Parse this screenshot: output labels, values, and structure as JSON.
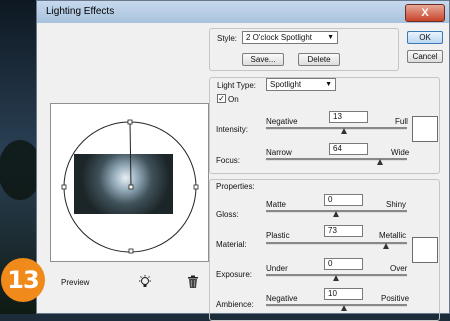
{
  "dialog": {
    "title": "Lighting Effects",
    "close_label": "X"
  },
  "style_group": {
    "style_label": "Style:",
    "style_value": "2 O'clock Spotlight",
    "save_label": "Save...",
    "delete_label": "Delete"
  },
  "buttons": {
    "ok": "OK",
    "cancel": "Cancel"
  },
  "light_type": {
    "label": "Light Type:",
    "value": "Spotlight",
    "on_label": "On",
    "on_checked": "✓"
  },
  "intensity": {
    "label": "Intensity:",
    "left": "Negative",
    "right": "Full",
    "value": "13"
  },
  "focus": {
    "label": "Focus:",
    "left": "Narrow",
    "right": "Wide",
    "value": "64"
  },
  "properties": {
    "label": "Properties:"
  },
  "gloss": {
    "label": "Gloss:",
    "left": "Matte",
    "right": "Shiny",
    "value": "0"
  },
  "material": {
    "label": "Material:",
    "left": "Plastic",
    "right": "Metallic",
    "value": "73"
  },
  "exposure": {
    "label": "Exposure:",
    "left": "Under",
    "right": "Over",
    "value": "0"
  },
  "ambience": {
    "label": "Ambience:",
    "left": "Negative",
    "right": "Positive",
    "value": "10"
  },
  "preview": {
    "label": "Preview"
  },
  "badge": {
    "number": "13"
  },
  "icons": {
    "light": "lightbulb-icon",
    "delete": "trash-icon"
  }
}
